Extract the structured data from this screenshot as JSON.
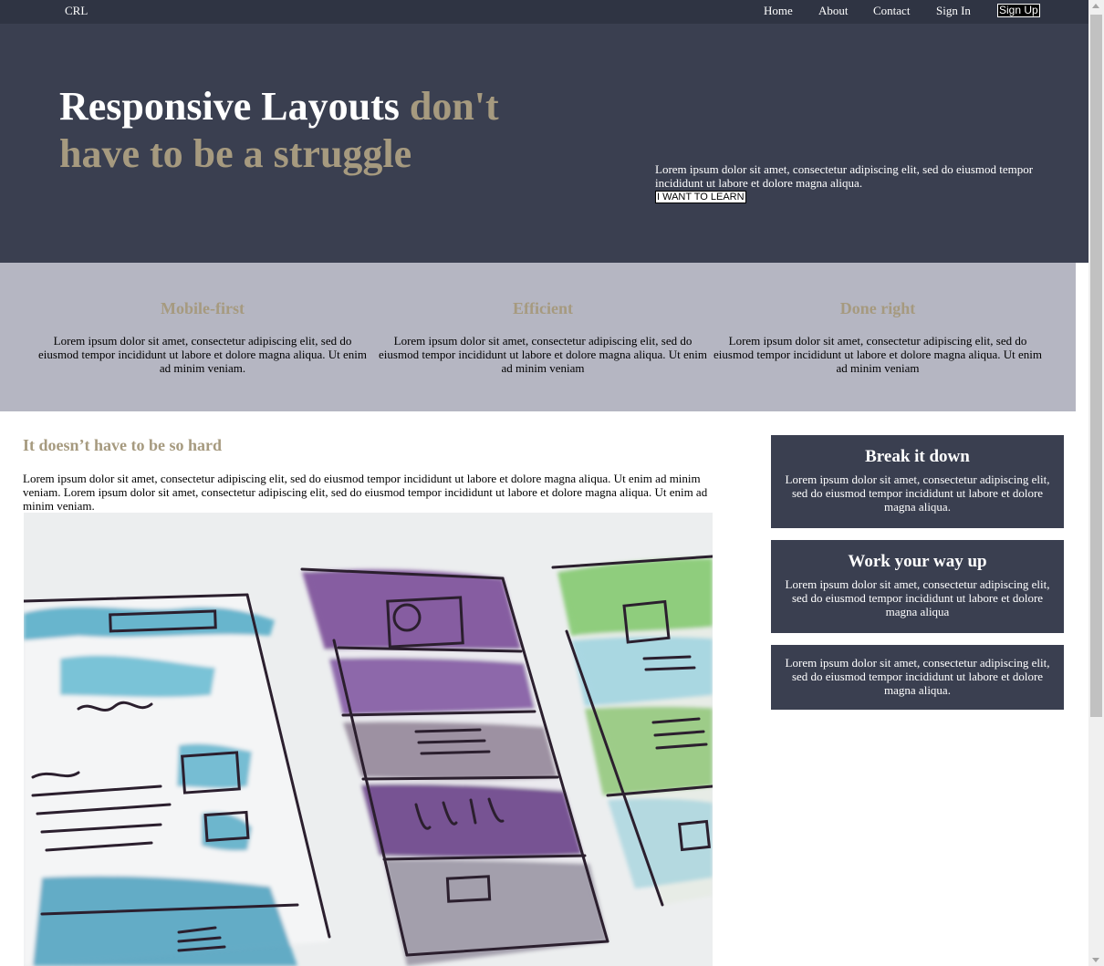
{
  "nav": {
    "logo": "CRL",
    "links": [
      "Home",
      "About",
      "Contact",
      "Sign In"
    ],
    "signup": "Sign Up"
  },
  "hero": {
    "title_white": "Responsive Layouts",
    "title_accent": "don't have to be a struggle",
    "blurb": "Lorem ipsum dolor sit amet, consectetur adipiscing elit, sed do eiusmod tempor incididunt ut labore et dolore magna aliqua.",
    "cta": "I WANT TO LEARN"
  },
  "features": [
    {
      "title": "Mobile-first",
      "text": "Lorem ipsum dolor sit amet, consectetur adipiscing elit, sed do eiusmod tempor incididunt ut labore et dolore magna aliqua. Ut enim ad minim veniam."
    },
    {
      "title": "Efficient",
      "text": "Lorem ipsum dolor sit amet, consectetur adipiscing elit, sed do eiusmod tempor incididunt ut labore et dolore magna aliqua. Ut enim ad minim veniam"
    },
    {
      "title": "Done right",
      "text": "Lorem ipsum dolor sit amet, consectetur adipiscing elit, sed do eiusmod tempor incididunt ut labore et dolore magna aliqua. Ut enim ad minim veniam"
    }
  ],
  "main": {
    "title": "It doesn’t have to be so hard",
    "body": "Lorem ipsum dolor sit amet, consectetur adipiscing elit, sed do eiusmod tempor incididunt ut labore et dolore magna aliqua. Ut enim ad minim veniam. Lorem ipsum dolor sit amet, consectetur adipiscing elit, sed do eiusmod tempor incididunt ut labore et dolore magna aliqua. Ut enim ad minim veniam."
  },
  "cards": [
    {
      "title": "Break it down",
      "text": "Lorem ipsum dolor sit amet, consectetur adipiscing elit, sed do eiusmod tempor incididunt ut labore et dolore magna aliqua."
    },
    {
      "title": "Work your way up",
      "text": "Lorem ipsum dolor sit amet, consectetur adipiscing elit, sed do eiusmod tempor incididunt ut labore et dolore magna aliqua"
    },
    {
      "title": "",
      "text": "Lorem ipsum dolor sit amet, consectetur adipiscing elit, sed do eiusmod tempor incididunt ut labore et dolore magna aliqua."
    }
  ],
  "colors": {
    "nav_bg": "#2f3443",
    "hero_bg": "#3a3f50",
    "accent": "#a69a7f",
    "features_bg": "#b5b6c2",
    "card_bg": "#3a3f50"
  }
}
